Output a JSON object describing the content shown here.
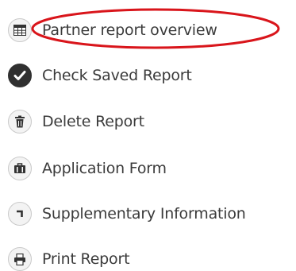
{
  "menu": {
    "items": [
      {
        "label": "Partner report overview",
        "icon": "table-grid-icon"
      },
      {
        "label": "Check Saved Report",
        "icon": "check-circle-icon"
      },
      {
        "label": "Delete Report",
        "icon": "trash-icon"
      },
      {
        "label": "Application Form",
        "icon": "briefcase-icon"
      },
      {
        "label": "Supplementary Information",
        "icon": "corner-arrow-icon"
      },
      {
        "label": "Print Report",
        "icon": "printer-icon"
      }
    ]
  },
  "annotation": {
    "highlight_color": "#d9151b"
  }
}
